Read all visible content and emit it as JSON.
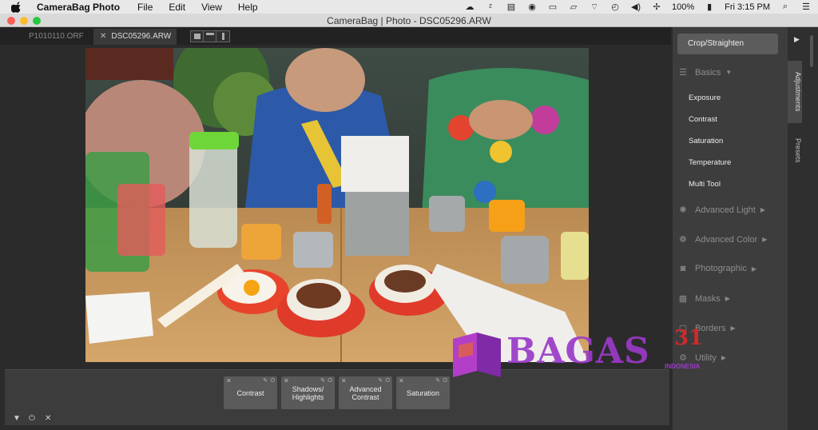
{
  "menubar": {
    "app_name": "CameraBag Photo",
    "items": [
      "File",
      "Edit",
      "View",
      "Help"
    ],
    "battery": "100%",
    "clock": "Fri 3:15 PM"
  },
  "window": {
    "title": "CameraBag | Photo - DSC05296.ARW"
  },
  "tabs": [
    {
      "label": "P1010110.ORF"
    },
    {
      "label": "DSC05296.ARW"
    }
  ],
  "sidebar": {
    "crop_label": "Crop/Straighten",
    "basics_label": "Basics",
    "basics_items": [
      "Exposure",
      "Contrast",
      "Saturation",
      "Temperature",
      "Multi Tool"
    ],
    "sections": [
      "Advanced Light",
      "Advanced Color",
      "Photographic",
      "Masks",
      "Borders",
      "Utility"
    ],
    "rail_tabs": [
      "Adjustments",
      "Presets"
    ]
  },
  "adjustments_strip": [
    {
      "label": "Contrast"
    },
    {
      "label": "Shadows/ Highlights"
    },
    {
      "label": "Advanced Contrast"
    },
    {
      "label": "Saturation"
    }
  ],
  "watermark": {
    "brand": "BAGAS",
    "number": "31",
    "country": "INDONESIA"
  },
  "colors": {
    "accent_panel": "#3d3d3d",
    "watermark_purple": "#9a3ac8",
    "watermark_red": "#cc2b2b"
  }
}
